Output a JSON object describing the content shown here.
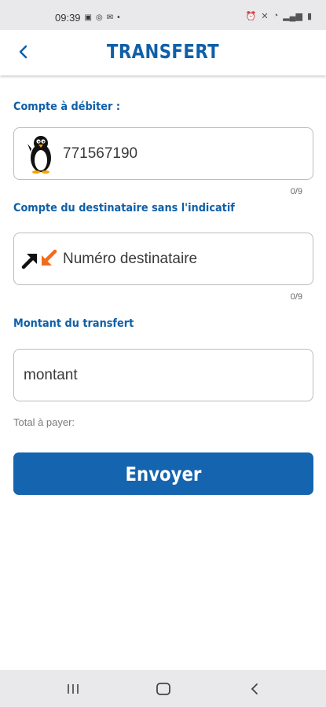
{
  "status_bar": {
    "time": "09:39",
    "left_icons": [
      "image-icon",
      "whatsapp-icon",
      "mail-icon",
      "dot-icon"
    ],
    "right_icons": [
      "alarm-icon",
      "mute-icon",
      "wifi-icon",
      "signal-icon",
      "battery-icon"
    ]
  },
  "header": {
    "title": "TRANSFERT",
    "back_icon": "chevron-left-icon",
    "accent_color": "#0f5fa8"
  },
  "debit": {
    "label": "Compte à débiter :",
    "value": "771567190",
    "counter": "0/9",
    "icon": "penguin-icon"
  },
  "recipient": {
    "label": "Compte du destinataire sans l'indicatif",
    "placeholder": "Numéro destinataire",
    "counter": "0/9",
    "icon": "transfer-arrows-icon"
  },
  "amount": {
    "label": "Montant du transfert",
    "placeholder": "montant"
  },
  "total_label": "Total à payer:",
  "send_button": {
    "label": "Envoyer",
    "color": "#1464b0"
  },
  "nav_bar": {
    "icons": [
      "recent-apps-icon",
      "home-icon",
      "back-icon"
    ]
  }
}
